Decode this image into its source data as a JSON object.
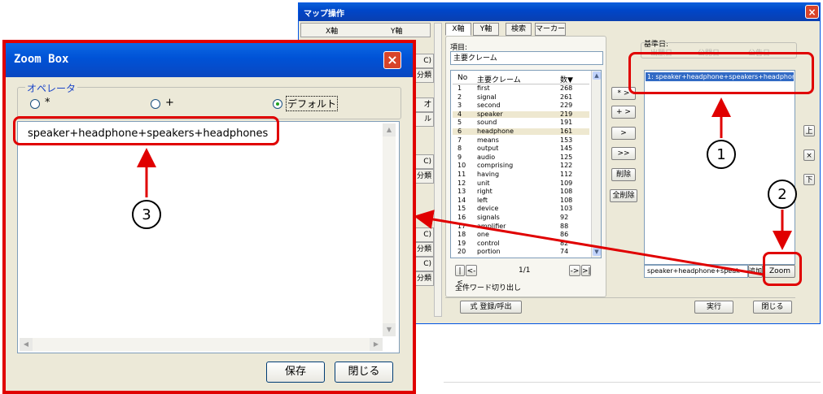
{
  "main_window": {
    "title": "マップ操作",
    "column_headers": [
      "X軸",
      "Y軸"
    ],
    "side_buttons": [
      "C)",
      "分類",
      "才",
      "ル",
      "C)",
      "分類",
      "C)",
      "分類",
      "C)",
      "分類"
    ],
    "tabs": [
      "X軸",
      "Y軸",
      "検索",
      "マーカー"
    ],
    "item_label": "項目:",
    "item_value": "主要クレーム",
    "table": {
      "headers": [
        "No",
        "主要クレーム",
        "数▼"
      ],
      "rows": [
        [
          "1",
          "first",
          "268"
        ],
        [
          "2",
          "signal",
          "261"
        ],
        [
          "3",
          "second",
          "229"
        ],
        [
          "4",
          "speaker",
          "219"
        ],
        [
          "5",
          "sound",
          "191"
        ],
        [
          "6",
          "headphone",
          "161"
        ],
        [
          "7",
          "means",
          "153"
        ],
        [
          "8",
          "output",
          "145"
        ],
        [
          "9",
          "audio",
          "125"
        ],
        [
          "10",
          "comprising",
          "122"
        ],
        [
          "11",
          "having",
          "112"
        ],
        [
          "12",
          "unit",
          "109"
        ],
        [
          "13",
          "right",
          "108"
        ],
        [
          "14",
          "left",
          "108"
        ],
        [
          "15",
          "device",
          "103"
        ],
        [
          "16",
          "signals",
          "92"
        ],
        [
          "17",
          "amplifier",
          "88"
        ],
        [
          "18",
          "one",
          "86"
        ],
        [
          "19",
          "control",
          "82"
        ],
        [
          "20",
          "portion",
          "74"
        ]
      ]
    },
    "pager": {
      "first": "|<",
      "prev": "<-",
      "page": "1/1",
      "next": "->",
      "last": ">|"
    },
    "extract_all_label": "全件ワード切り出し",
    "op_buttons": [
      "* >",
      "+ >",
      ">",
      ">>",
      "削除",
      "全削除"
    ],
    "basis_label": "基準日:",
    "basis_options": [
      "出願日",
      "公開日",
      "公告日"
    ],
    "selected_item": "1: speaker+headphone+speakers+headphones",
    "order_buttons": [
      "上",
      "×",
      "下"
    ],
    "formula_value": "speaker+headphone+speak",
    "add_button": "追加",
    "zoom_button": "Zoom",
    "register_button": "式 登録/呼出",
    "run_button": "実行",
    "close_button": "閉じる"
  },
  "zoom_box": {
    "title": "Zoom Box",
    "operator_label": "オペレータ",
    "operators": [
      "*",
      "+",
      "デフォルト"
    ],
    "selected_operator": "デフォルト",
    "text": "speaker+headphone+speakers+headphones",
    "save_button": "保存",
    "close_button": "閉じる"
  },
  "callouts": [
    "1",
    "2",
    "3"
  ],
  "colors": {
    "annotation_red": "#e00000",
    "title_blue": "#0052d6"
  }
}
